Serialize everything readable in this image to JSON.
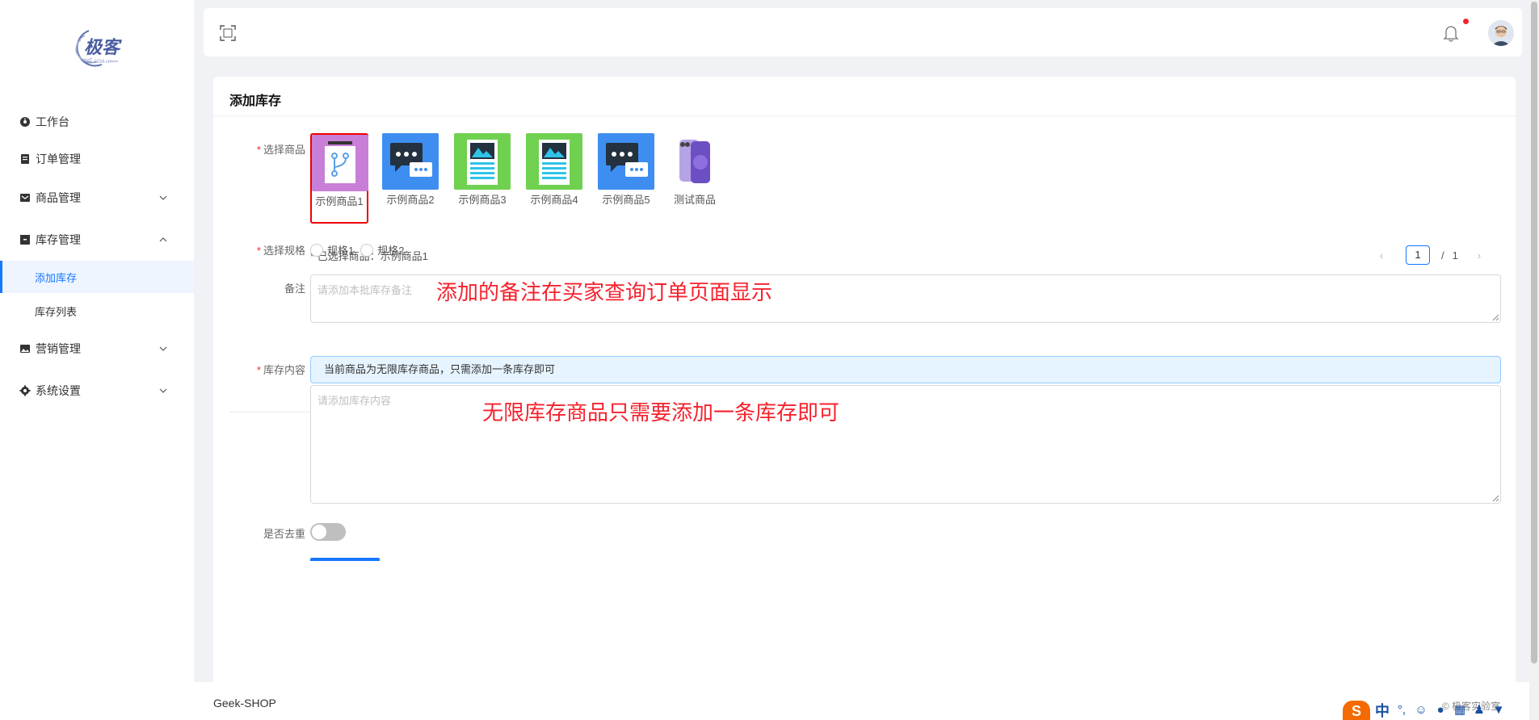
{
  "brand": {
    "logo_text": "极客",
    "logo_sub": "1234.cn"
  },
  "sidebar": {
    "items": [
      {
        "label": "工作台",
        "icon": "dashboard-icon"
      },
      {
        "label": "订单管理",
        "icon": "order-icon"
      },
      {
        "label": "商品管理",
        "icon": "goods-icon",
        "expanded": false
      },
      {
        "label": "库存管理",
        "icon": "inventory-icon",
        "expanded": true,
        "children": [
          {
            "label": "添加库存",
            "active": true
          },
          {
            "label": "库存列表",
            "active": false
          }
        ]
      },
      {
        "label": "营销管理",
        "icon": "marketing-icon",
        "expanded": false
      },
      {
        "label": "系统设置",
        "icon": "settings-icon",
        "expanded": false
      }
    ]
  },
  "header": {
    "fullscreen_icon": "fullscreen-icon",
    "bell_icon": "bell-icon",
    "has_notification": true
  },
  "page": {
    "title": "添加库存",
    "select_product_label": "选择商品",
    "products": [
      {
        "name": "示例商品1",
        "color": "#c97fd8",
        "icon": "branch-icon",
        "selected": true
      },
      {
        "name": "示例商品2",
        "color": "#3d8ef0",
        "icon": "chat-icon",
        "selected": false
      },
      {
        "name": "示例商品3",
        "color": "#6fd14f",
        "icon": "document-icon",
        "selected": false
      },
      {
        "name": "示例商品4",
        "color": "#6fd14f",
        "icon": "document-icon",
        "selected": false
      },
      {
        "name": "示例商品5",
        "color": "#3d8ef0",
        "icon": "chat-icon",
        "selected": false
      },
      {
        "name": "测试商品",
        "color": "#ffffff",
        "icon": "phone-icon",
        "selected": false
      }
    ],
    "selected_text": "* 已选择商品：示例商品1",
    "pager": {
      "current": "1",
      "separator": "/",
      "total": "1"
    },
    "spec_label": "选择规格",
    "specs": [
      "规格1",
      "规格2"
    ],
    "remark_label": "备注",
    "remark_placeholder": "请添加本批库存备注",
    "remark_annotation": "添加的备注在买家查询订单页面显示",
    "content_label": "库存内容",
    "content_alert": "当前商品为无限库存商品，只需添加一条库存即可",
    "content_placeholder": "请添加库存内容",
    "content_annotation": "无限库存商品只需要添加一条库存即可",
    "dedupe_label": "是否去重",
    "dedupe_on": false
  },
  "footer": {
    "text": "Geek-SHOP",
    "right_text": "© 极客实验室"
  },
  "ime": {
    "logo": "S",
    "lang": "中"
  }
}
